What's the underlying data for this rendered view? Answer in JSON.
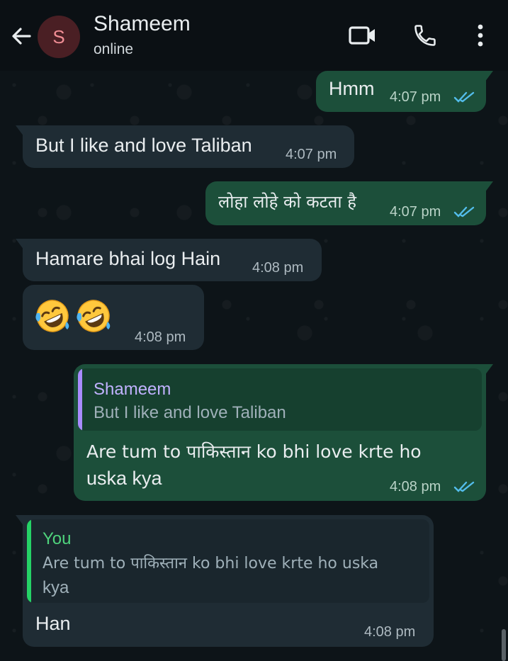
{
  "header": {
    "contact_name": "Shameem",
    "status": "online",
    "avatar_initial": "S"
  },
  "colors": {
    "incoming_bubble": "#1f2c34",
    "outgoing_bubble": "#1c4f3a",
    "read_ticks": "#53bdeb",
    "quote_self": "#a98cff",
    "quote_other": "#25d366"
  },
  "messages": [
    {
      "direction": "out",
      "text": "Hmm",
      "time": "4:07 pm",
      "ticks": "read"
    },
    {
      "direction": "in",
      "text": "But I like and love Taliban",
      "time": "4:07 pm"
    },
    {
      "direction": "out",
      "text": "लोहा लोहे को कटता है",
      "time": "4:07 pm",
      "ticks": "read"
    },
    {
      "direction": "in",
      "text": "Hamare bhai log Hain",
      "time": "4:08 pm"
    },
    {
      "direction": "in",
      "emojis": [
        "rolling-on-floor-laughing",
        "rolling-on-floor-laughing"
      ],
      "time": "4:08 pm"
    },
    {
      "direction": "out",
      "quote": {
        "author": "Shameem",
        "text": "But I like and love Taliban"
      },
      "lines": [
        "Are tum to पाकिस्तान ko bhi love krte ho",
        "uska kya"
      ],
      "time": "4:08 pm",
      "ticks": "read"
    },
    {
      "direction": "in",
      "quote": {
        "author": "You",
        "lines": [
          "Are tum to पाकिस्तान ko bhi love krte ho uska",
          "kya"
        ]
      },
      "text": "Han",
      "time": "4:08 pm"
    }
  ]
}
